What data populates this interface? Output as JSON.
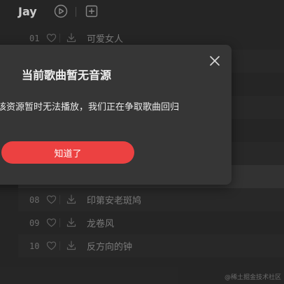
{
  "header": {
    "artist": "Jay",
    "play_icon": "play-circle-icon",
    "add_icon": "add-square-icon"
  },
  "songs": [
    {
      "num": "01",
      "title": "可爱女人"
    },
    {
      "num": "",
      "title": ""
    },
    {
      "num": "",
      "title": ""
    },
    {
      "num": "",
      "title": ""
    },
    {
      "num": "",
      "title": ""
    },
    {
      "num": "",
      "title": ""
    },
    {
      "num": "",
      "title": ""
    },
    {
      "num": "08",
      "title": "印第安老斑鸠"
    },
    {
      "num": "09",
      "title": "龙卷风"
    },
    {
      "num": "10",
      "title": "反方向的钟"
    }
  ],
  "dialog": {
    "title": "当前歌曲暂无音源",
    "message": "该资源暂时无法播放，我们正在争取歌曲回归",
    "confirm_label": "知道了",
    "close_icon": "close-icon"
  },
  "watermark": "@稀土掘金技术社区",
  "colors": {
    "background": "#2b2b2b",
    "dialog": "#363636",
    "accent": "#ec4141"
  }
}
